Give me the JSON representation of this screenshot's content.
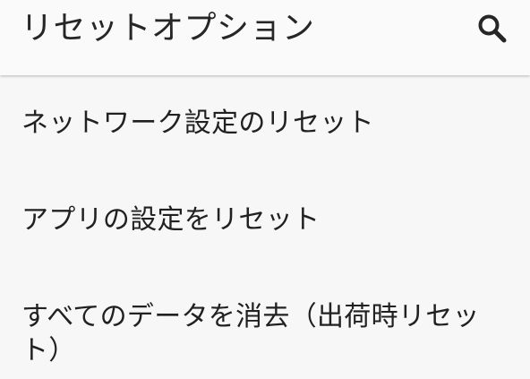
{
  "app_bar": {
    "title": "リセットオプション",
    "search_icon": "search-icon"
  },
  "options": [
    {
      "label": "ネットワーク設定のリセット"
    },
    {
      "label": "アプリの設定をリセット"
    },
    {
      "label": "すべてのデータを消去（出荷時リセット）"
    }
  ],
  "colors": {
    "background": "#f7f7f7",
    "app_bar": "#fafafa",
    "text": "#212121"
  }
}
